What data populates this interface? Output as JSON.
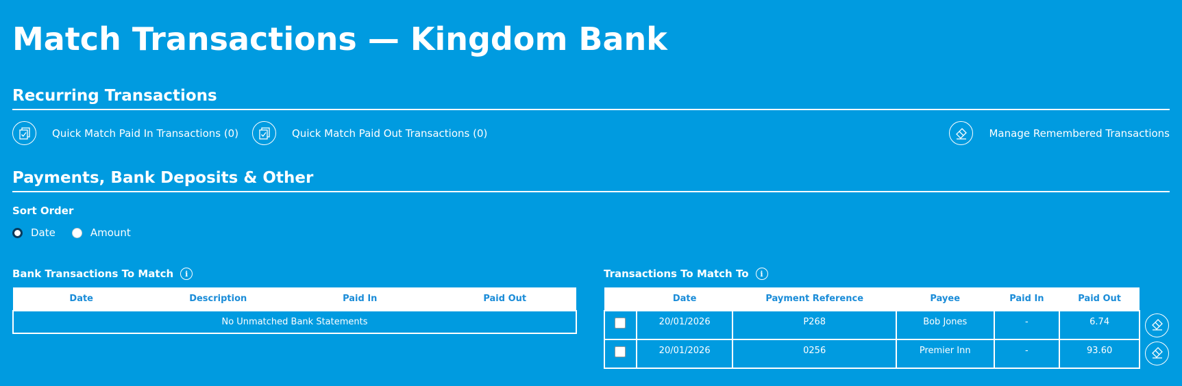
{
  "page": {
    "title": "Match Transactions — Kingdom Bank"
  },
  "recurring": {
    "heading": "Recurring Transactions",
    "quick_match_in": "Quick Match Paid In Transactions (0)",
    "quick_match_out": "Quick Match Paid Out Transactions (0)",
    "manage_remembered": "Manage Remembered Transactions",
    "icons": [
      "checklist-icon",
      "checklist-icon",
      "eraser-icon"
    ]
  },
  "payments": {
    "heading": "Payments, Bank Deposits & Other",
    "sort_order": {
      "label": "Sort Order",
      "options": [
        "Date",
        "Amount"
      ],
      "selected": "Date"
    }
  },
  "bank_table": {
    "title": "Bank Transactions To Match",
    "columns": [
      "Date",
      "Description",
      "Paid In",
      "Paid Out"
    ],
    "empty_message": "No Unmatched Bank Statements"
  },
  "match_table": {
    "title": "Transactions To Match To",
    "columns": [
      "",
      "Date",
      "Payment Reference",
      "Payee",
      "Paid In",
      "Paid Out"
    ],
    "rows": [
      {
        "date": "20/01/2026",
        "reference": "P268",
        "payee": "Bob Jones",
        "paid_in": "-",
        "paid_out": "6.74",
        "checked": false
      },
      {
        "date": "20/01/2026",
        "reference": "0256",
        "payee": "Premier Inn",
        "paid_in": "-",
        "paid_out": "93.60",
        "checked": false
      }
    ]
  },
  "colors": {
    "background": "#009be0",
    "text": "#ffffff",
    "header_text": "#1a8cd8"
  }
}
